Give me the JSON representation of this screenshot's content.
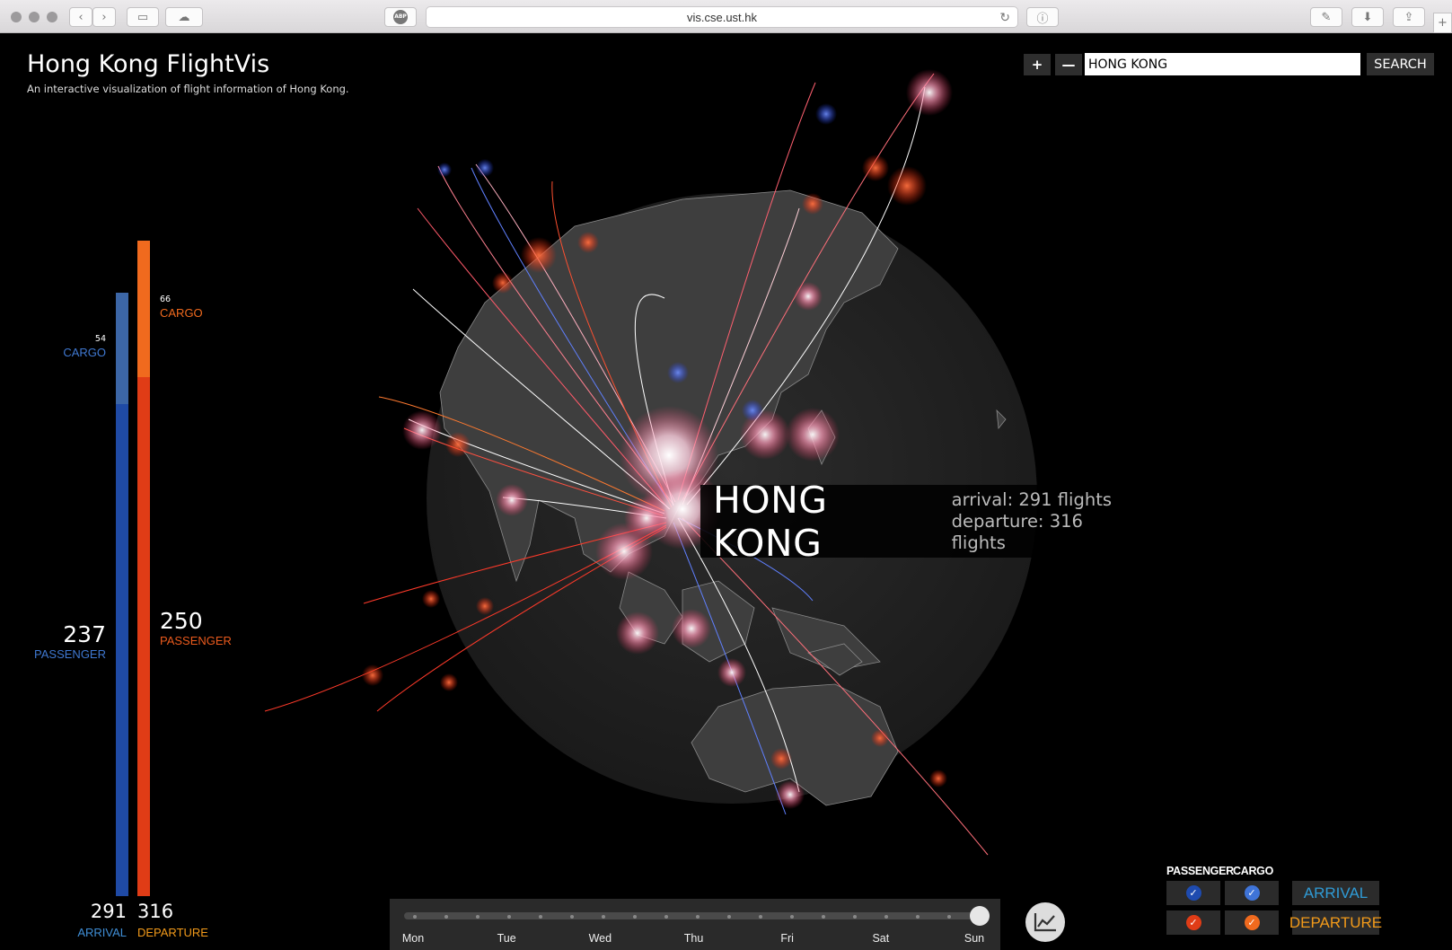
{
  "browser": {
    "url": "vis.cse.ust.hk",
    "adblock_label": "ABP"
  },
  "header": {
    "title": "Hong Kong FlightVis",
    "subtitle": "An interactive visualization of flight information of Hong Kong."
  },
  "search": {
    "zoom_in_label": "+",
    "zoom_out_label": "—",
    "value": "HONG KONG",
    "button_label": "SEARCH"
  },
  "stats": {
    "arrival": {
      "cargo_value": "54",
      "cargo_label": "CARGO",
      "passenger_value": "237",
      "passenger_label": "PASSENGER",
      "total_value": "291",
      "total_label": "ARRIVAL",
      "color_cargo": "#3c66a6",
      "color_passenger": "#1f4aa5"
    },
    "departure": {
      "cargo_value": "66",
      "cargo_label": "CARGO",
      "passenger_value": "250",
      "passenger_label": "PASSENGER",
      "total_value": "316",
      "total_label": "DEPARTURE",
      "color_cargo": "#f06a1e",
      "color_passenger": "#e03c16"
    }
  },
  "tooltip": {
    "name": "HONG KONG",
    "arrival_text": "arrival: 291 flights",
    "departure_text": "departure: 316 flights"
  },
  "timeline": {
    "days": [
      "Mon",
      "Tue",
      "Wed",
      "Thu",
      "Fri",
      "Sat",
      "Sun"
    ],
    "selected_day": "Sun"
  },
  "filters": {
    "passenger_label": "PASSENGER",
    "cargo_label": "CARGO",
    "arrival_label": "ARRIVAL",
    "departure_label": "DEPARTURE",
    "arrival_color": "#2f9bd6",
    "departure_color": "#f29a1a",
    "arrival_passenger_checked": true,
    "arrival_cargo_checked": true,
    "departure_passenger_checked": true,
    "departure_cargo_checked": true
  },
  "icons": {
    "chart_button": "line-chart-icon"
  }
}
